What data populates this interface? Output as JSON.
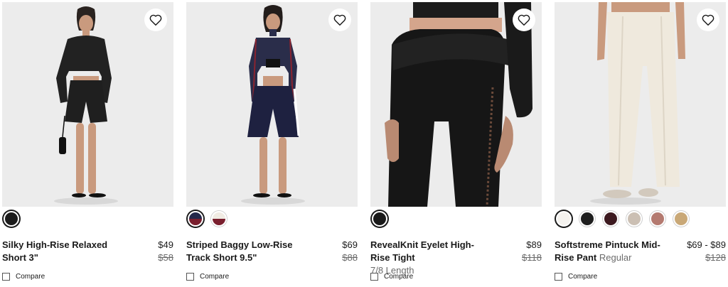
{
  "products": [
    {
      "name": "Silky High-Rise Relaxed Short 3\"",
      "subtitle": "",
      "price": "$49",
      "original_price": "$58",
      "compare_label": "Compare",
      "swatches": [
        {
          "color": "#1c1c1c",
          "selected": true
        }
      ]
    },
    {
      "name": "Striped Baggy Low-Rise Track Short 9.5\"",
      "subtitle": "",
      "price": "$69",
      "original_price": "$88",
      "compare_label": "Compare",
      "swatches": [
        {
          "color": "#24284a",
          "selected": true
        },
        {
          "color": "#f0ebe3",
          "selected": false
        }
      ]
    },
    {
      "name": "RevealKnit Eyelet High-Rise Tight",
      "subtitle": "7/8 Length",
      "price": "$89",
      "original_price": "$118",
      "compare_label": "Compare",
      "swatches": [
        {
          "color": "#1a1a1a",
          "selected": true
        }
      ]
    },
    {
      "name": "Softstreme Pintuck Mid-Rise Pant",
      "subtitle": "Regular",
      "price": "$69 - $89",
      "original_price": "$128",
      "compare_label": "Compare",
      "swatches": [
        {
          "color": "#f4f2ee",
          "selected": true
        },
        {
          "color": "#1e1e1e",
          "selected": false
        },
        {
          "color": "#3d1a20",
          "selected": false
        },
        {
          "color": "#cbbfb3",
          "selected": false
        },
        {
          "color": "#b47a70",
          "selected": false
        },
        {
          "color": "#c9a877",
          "selected": false
        }
      ]
    }
  ]
}
